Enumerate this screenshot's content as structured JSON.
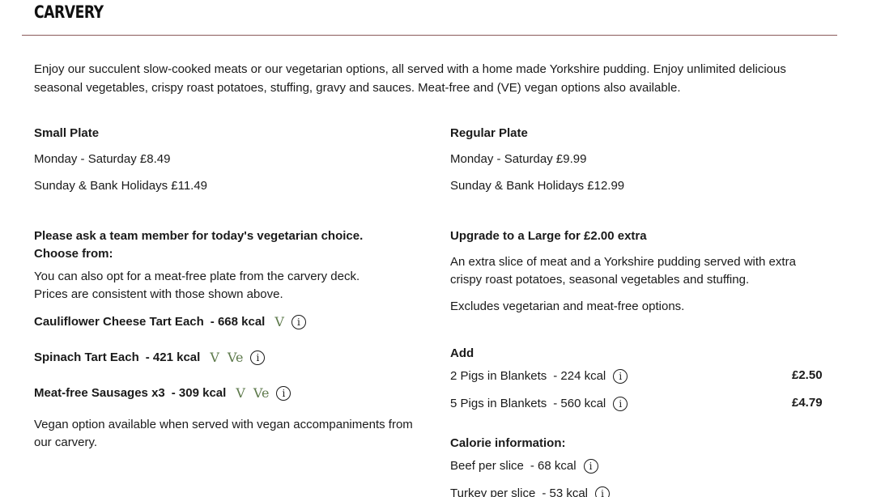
{
  "section": {
    "title": "CARVERY",
    "intro": "Enjoy our succulent slow-cooked meats or our vegetarian options, all served with a home made Yorkshire pudding. Enjoy unlimited delicious seasonal vegetables, crispy roast potatoes, stuffing, gravy and sauces. Meat-free and (VE) vegan options also available."
  },
  "small_plate": {
    "heading": "Small Plate",
    "weekday": "Monday - Saturday £8.49",
    "weekend": "Sunday & Bank Holidays £11.49"
  },
  "regular_plate": {
    "heading": "Regular Plate",
    "weekday": "Monday - Saturday £9.99",
    "weekend": "Sunday & Bank Holidays £12.99"
  },
  "vegetarian": {
    "heading_line1": "Please ask a team member for today's vegetarian choice.",
    "heading_line2": "Choose from:",
    "note": "You can also opt for a meat-free plate from the carvery deck. Prices are consistent with those shown above.",
    "items": [
      {
        "name": "Cauliflower Cheese Tart Each",
        "kcal": "- 668 kcal",
        "diet": [
          "V"
        ]
      },
      {
        "name": "Spinach Tart Each",
        "kcal": "- 421 kcal",
        "diet": [
          "V",
          "Ve"
        ]
      },
      {
        "name": "Meat-free Sausages x3",
        "kcal": "- 309 kcal",
        "diet": [
          "V",
          "Ve"
        ]
      }
    ],
    "vegan_note": "Vegan option available when served with vegan accompaniments from our carvery."
  },
  "upgrade": {
    "heading": "Upgrade to a Large for £2.00 extra",
    "description": "An extra slice of meat and a Yorkshire pudding served with extra crispy roast potatoes, seasonal vegetables and stuffing.",
    "exclusion": "Excludes vegetarian and meat-free options."
  },
  "add": {
    "heading": "Add",
    "items": [
      {
        "name": "2 Pigs in Blankets",
        "kcal": "- 224 kcal",
        "price": "£2.50"
      },
      {
        "name": "5 Pigs in Blankets",
        "kcal": "- 560 kcal",
        "price": "£4.79"
      }
    ]
  },
  "calories": {
    "heading": "Calorie information:",
    "items": [
      {
        "name": "Beef per slice",
        "kcal": "- 68 kcal"
      },
      {
        "name": "Turkey per slice",
        "kcal": "- 53 kcal"
      }
    ]
  },
  "icons": {
    "info": "info-circle-icon",
    "vegetarian": "vegetarian-icon",
    "vegan": "vegan-icon"
  },
  "colors": {
    "divider": "#8a5a5a",
    "diet_mark": "#5e7a4c",
    "text": "#1a1a1a"
  }
}
